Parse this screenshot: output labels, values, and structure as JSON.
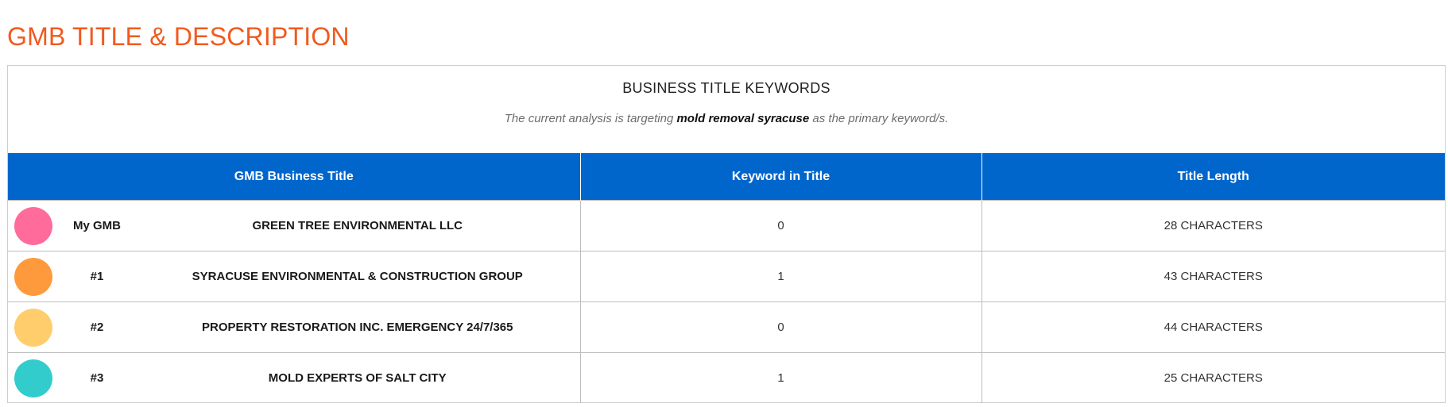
{
  "section": {
    "title": "GMB TITLE & DESCRIPTION"
  },
  "panel": {
    "heading": "BUSINESS TITLE KEYWORDS",
    "note_prefix": "The current analysis is targeting ",
    "note_keyword": "mold removal syracuse",
    "note_suffix": " as the primary keyword/s."
  },
  "table": {
    "headers": [
      "GMB Business Title",
      "Keyword in Title",
      "Title Length"
    ],
    "rows": [
      {
        "rank": "My GMB",
        "color": "#ff6b9a",
        "title": "GREEN TREE ENVIRONMENTAL LLC",
        "keywords": "0",
        "length": "28 CHARACTERS"
      },
      {
        "rank": "#1",
        "color": "#ff9a3c",
        "title": "SYRACUSE ENVIRONMENTAL & CONSTRUCTION GROUP",
        "keywords": "1",
        "length": "43 CHARACTERS"
      },
      {
        "rank": "#2",
        "color": "#ffcd6b",
        "title": "PROPERTY RESTORATION INC. EMERGENCY 24/7/365",
        "keywords": "0",
        "length": "44 CHARACTERS"
      },
      {
        "rank": "#3",
        "color": "#33cccc",
        "title": "MOLD EXPERTS OF SALT CITY",
        "keywords": "1",
        "length": "25 CHARACTERS"
      }
    ]
  },
  "colors": {
    "accent_title": "#f05a1e",
    "header_bg": "#0066cc"
  }
}
